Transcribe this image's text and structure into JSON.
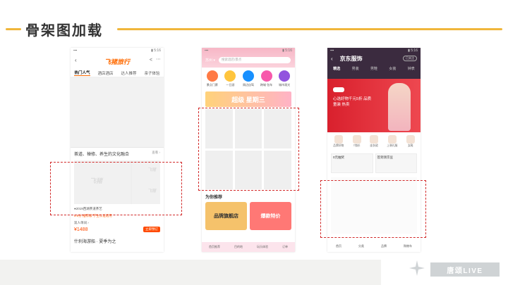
{
  "header": {
    "title": "骨架图加载"
  },
  "phone1": {
    "logo": "飞猪旅行",
    "tabs": [
      "热门人气",
      "酒店酒店",
      "达人推荐",
      "亲子体验"
    ],
    "article_title": "茶道、禅修、养生的文化融合",
    "article_more": "查看 ›",
    "watermark_a": "飞猪",
    "watermark_b": "飞猪",
    "watermark_c": "飞猪",
    "line1": "●2019西湖茶道茶艺",
    "line2": "8.9分 推荐级  学生认证适用",
    "line3": "双人单间 ›",
    "price": "¥1488",
    "buy_label": "立即预订",
    "bottom": "什刹海游船 · 夏季为之"
  },
  "phone2": {
    "city": "苏州 ▾",
    "search_placeholder": "搜索酒店/景点",
    "icons": [
      {
        "label": "景点门票",
        "color": "#ff7a45"
      },
      {
        "label": "一日游",
        "color": "#ffc53d"
      },
      {
        "label": "周边自驾",
        "color": "#1890ff"
      },
      {
        "label": "跨城·包车",
        "color": "#f759ab"
      },
      {
        "label": "城市观光",
        "color": "#9254de"
      }
    ],
    "banner": "超级 星期三",
    "rec_title": "为你推荐",
    "rec_cards": [
      {
        "label": "品牌旗舰店",
        "color": "#f5c26b"
      },
      {
        "label": "爆款特价",
        "color": "#ff7875"
      }
    ],
    "nav": [
      "首页推荐",
      "目的地",
      "玩乐体验",
      "订单"
    ]
  },
  "phone3": {
    "title": "京东服饰",
    "pill": "已关注",
    "cats": [
      "精选",
      "男装",
      "男鞋",
      "女装",
      "钟表"
    ],
    "hero_text": "心选好物千元5折 品质童装 热卖",
    "prods": [
      "品牌好物",
      "T恤衫",
      "连衣裙",
      "上装礼服",
      "女鞋"
    ],
    "card1": "0元抽奖",
    "card2": "签到领京豆",
    "nav": [
      "首页",
      "分类",
      "品牌",
      "购物车"
    ]
  },
  "footer": {
    "brand": "唐颂LIVE"
  }
}
